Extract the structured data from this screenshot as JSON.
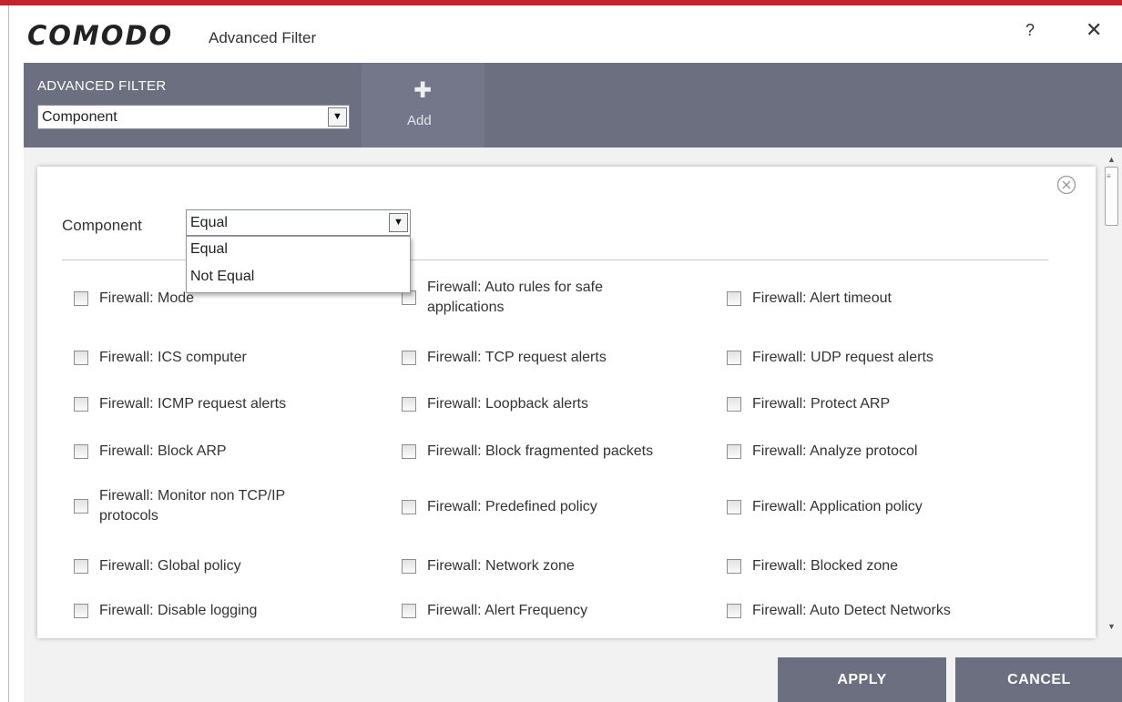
{
  "window": {
    "logo": "COMODO",
    "title": "Advanced Filter",
    "help": "?",
    "close": "✕"
  },
  "toolbar": {
    "filter_label": "ADVANCED FILTER",
    "filter_value": "Component",
    "add_icon": "plus-icon",
    "add_label": "Add"
  },
  "condition": {
    "label": "Component",
    "selected": "Equal",
    "options": [
      "Equal",
      "Not Equal"
    ]
  },
  "checkboxes": [
    {
      "label": "Firewall: Mode",
      "checked": false
    },
    {
      "label": "Firewall: Auto rules for safe applications",
      "checked": false
    },
    {
      "label": "Firewall: Alert timeout",
      "checked": false
    },
    {
      "label": "Firewall: ICS computer",
      "checked": false
    },
    {
      "label": "Firewall: TCP request alerts",
      "checked": false
    },
    {
      "label": "Firewall: UDP request alerts",
      "checked": false
    },
    {
      "label": "Firewall: ICMP request alerts",
      "checked": false
    },
    {
      "label": "Firewall: Loopback alerts",
      "checked": false
    },
    {
      "label": "Firewall: Protect ARP",
      "checked": false
    },
    {
      "label": "Firewall: Block ARP",
      "checked": false
    },
    {
      "label": "Firewall: Block fragmented packets",
      "checked": false
    },
    {
      "label": "Firewall: Analyze protocol",
      "checked": false
    },
    {
      "label": "Firewall: Monitor non TCP/IP protocols",
      "checked": false
    },
    {
      "label": "Firewall: Predefined policy",
      "checked": false
    },
    {
      "label": "Firewall: Application policy",
      "checked": false
    },
    {
      "label": "Firewall: Global policy",
      "checked": false
    },
    {
      "label": "Firewall: Network zone",
      "checked": false
    },
    {
      "label": "Firewall: Blocked zone",
      "checked": false
    },
    {
      "label": "Firewall: Disable logging",
      "checked": false
    },
    {
      "label": "Firewall: Alert Frequency",
      "checked": false
    },
    {
      "label": "Firewall: Auto Detect Networks",
      "checked": false
    }
  ],
  "buttons": {
    "apply": "APPLY",
    "cancel": "CANCEL"
  },
  "colors": {
    "toolbar": "#6b6f80",
    "accent": "#c8232c",
    "button": "#6b6f80"
  }
}
